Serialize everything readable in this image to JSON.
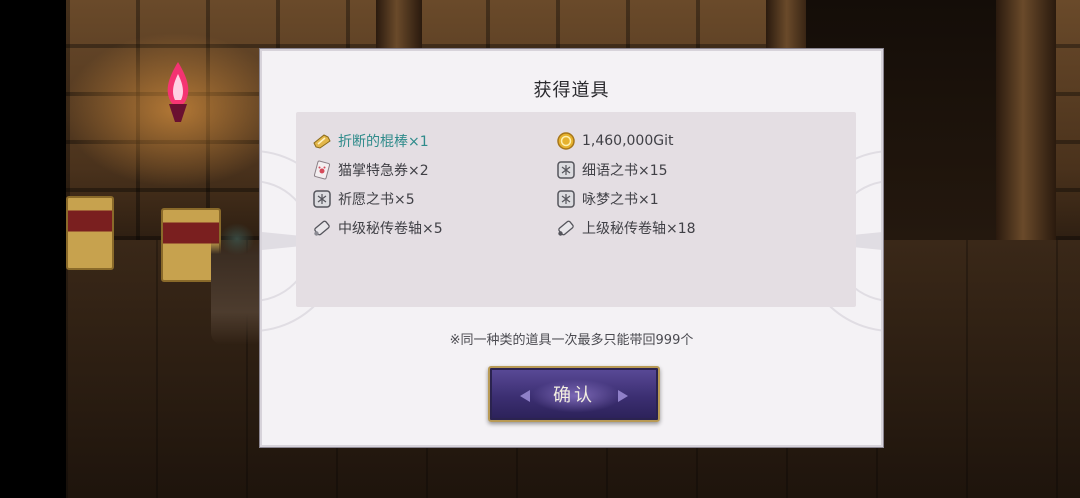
{
  "dialog": {
    "title": "获得道具",
    "note": "※同一种类的道具一次最多只能带回999个",
    "confirm_label": "确认"
  },
  "items": [
    {
      "label": "折断的棍棒×1",
      "icon": "broken-stick-icon",
      "highlight": true
    },
    {
      "label": "1,460,000Git",
      "icon": "gold-coin-icon",
      "highlight": false
    },
    {
      "label": "猫掌特急券×2",
      "icon": "paw-ticket-icon",
      "highlight": false
    },
    {
      "label": "细语之书×15",
      "icon": "book-icon",
      "highlight": false
    },
    {
      "label": "祈愿之书×5",
      "icon": "book-icon",
      "highlight": false
    },
    {
      "label": "咏梦之书×1",
      "icon": "book-icon",
      "highlight": false
    },
    {
      "label": "中级秘传卷轴×5",
      "icon": "scroll-icon",
      "highlight": false
    },
    {
      "label": "上级秘传卷轴×18",
      "icon": "scroll-icon",
      "highlight": false
    }
  ],
  "colors": {
    "highlight_text": "#2f8b8b",
    "dialog_bg": "#f4f2f5",
    "items_box_bg": "#e4dee3",
    "button_purple": "#3c2f72",
    "button_border": "#b89a55"
  }
}
